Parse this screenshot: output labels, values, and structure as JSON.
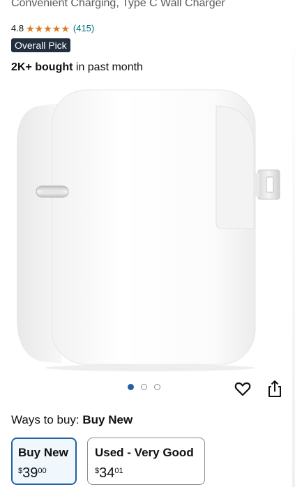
{
  "product": {
    "title": "Convenient Charging, Type C Wall Charger",
    "rating": "4.8",
    "stars": 5,
    "review_count": "(415)",
    "badge": "Overall Pick",
    "bought_bold": "2K+ bought",
    "bought_rest": " in past month"
  },
  "gallery": {
    "image_count": 3,
    "active_index": 0
  },
  "ways": {
    "label": "Ways to buy:",
    "selected": "Buy New"
  },
  "options": [
    {
      "label": "Buy New",
      "currency": "$",
      "whole": "39",
      "fraction": "00"
    },
    {
      "label": "Used - Very Good",
      "currency": "$",
      "whole": "34",
      "fraction": "01"
    }
  ],
  "colors": {
    "star": "#de7921",
    "link": "#007185",
    "badge_bg": "#232f3e",
    "selected_border": "#2162a1"
  },
  "icons": {
    "heart": "heart-icon",
    "share": "share-icon"
  }
}
